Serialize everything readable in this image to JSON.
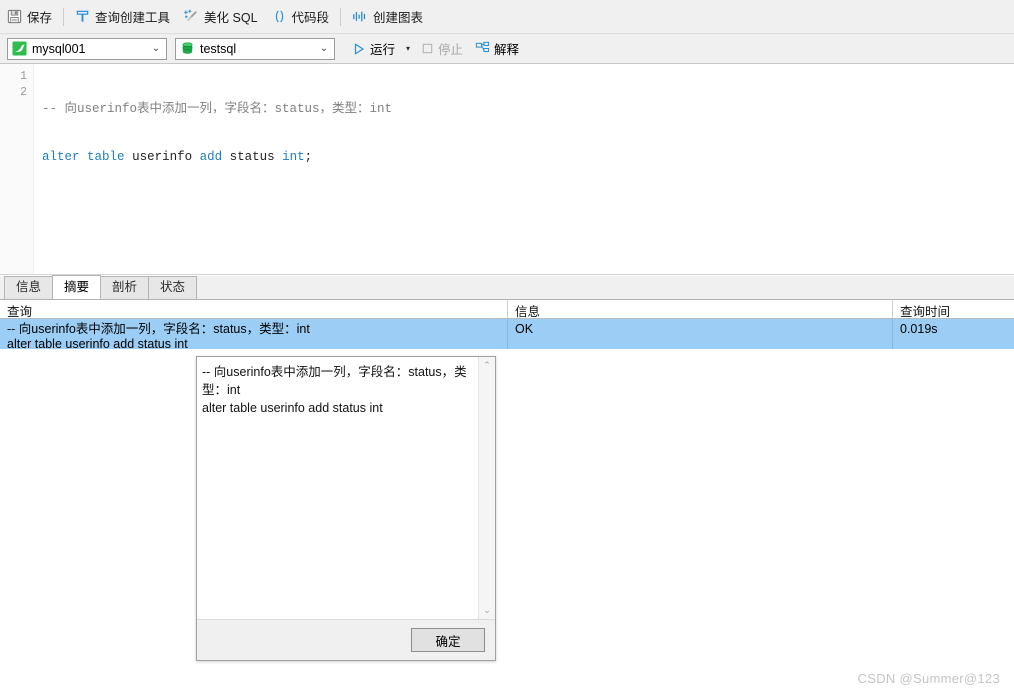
{
  "toolbar_primary": {
    "items": [
      {
        "label": "保存",
        "icon": "save-floppy-icon"
      },
      {
        "label": "查询创建工具",
        "icon": "query-builder-icon"
      },
      {
        "label": "美化 SQL",
        "icon": "magic-wand-icon"
      },
      {
        "label": "代码段",
        "icon": "parentheses-icon"
      },
      {
        "label": "创建图表",
        "icon": "bar-chart-icon"
      }
    ]
  },
  "toolbar_secondary": {
    "connection": {
      "value": "mysql001",
      "icon": "mysql-dolphin-icon",
      "caret": "⌄"
    },
    "database": {
      "value": "testsql",
      "icon": "database-cylinder-icon",
      "caret": "⌄"
    },
    "run": {
      "label": "运行",
      "icon": "play-triangle-icon",
      "dropdown_caret": "▾"
    },
    "stop": {
      "label": "停止",
      "icon": "stop-square-icon",
      "disabled": true
    },
    "explain": {
      "label": "解释",
      "icon": "explain-plan-icon"
    }
  },
  "editor": {
    "line_numbers": [
      "1",
      "2"
    ],
    "line1": {
      "comment": "-- 向userinfo表中添加一列，字段名：status，类型：int"
    },
    "line2": {
      "kw_alter": "alter",
      "kw_table": "table",
      "ident_userinfo": "userinfo",
      "kw_add": "add",
      "ident_status": "status",
      "kw_int": "int",
      "semicolon": ";"
    }
  },
  "tabs": [
    {
      "label": "信息",
      "active": false
    },
    {
      "label": "摘要",
      "active": true
    },
    {
      "label": "剖析",
      "active": false
    },
    {
      "label": "状态",
      "active": false
    }
  ],
  "results": {
    "columns": [
      "查询",
      "信息",
      "查询时间"
    ],
    "rows": [
      {
        "query": "-- 向userinfo表中添加一列，字段名：status，类型：int\nalter table userinfo add status int",
        "info": "OK",
        "time": "0.019s"
      }
    ],
    "selected_row_color": "#9ccdf5"
  },
  "dialog": {
    "content": "-- 向userinfo表中添加一列，字段名：status，类型：int\nalter table userinfo add status int",
    "ok_label": "确定",
    "scroll_up": "⌃",
    "scroll_down": "⌄"
  },
  "watermark": {
    "text": "CSDN @Summer@123"
  }
}
